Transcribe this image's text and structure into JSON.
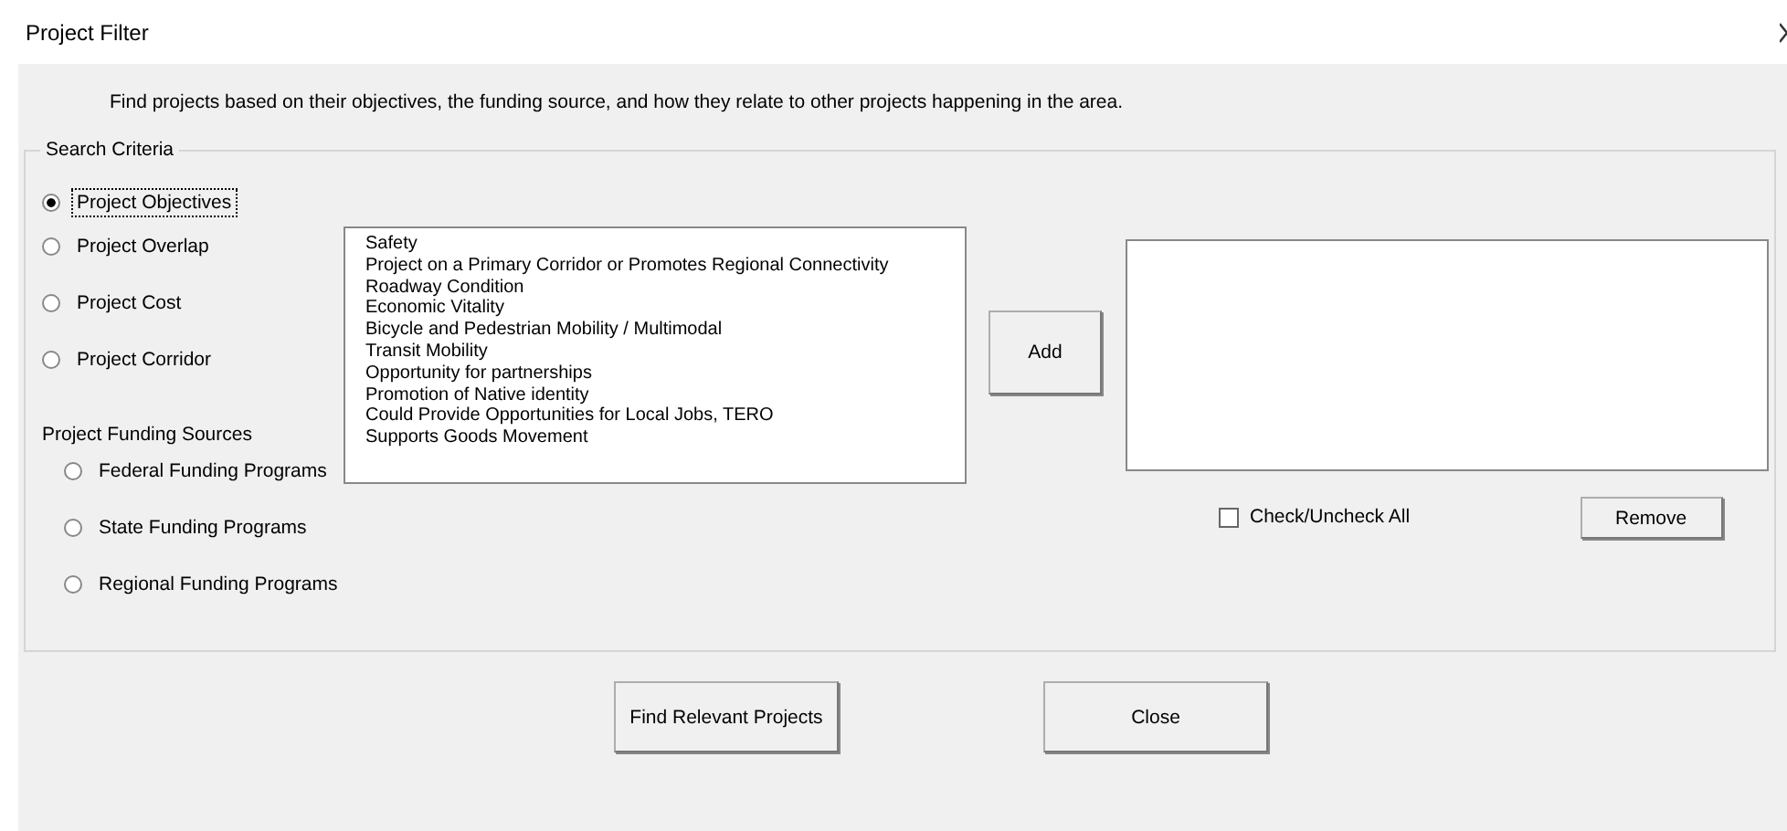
{
  "window": {
    "title": "Project Filter"
  },
  "description": "Find projects based on their objectives, the funding source, and how they relate to other projects happening in the area.",
  "search_criteria": {
    "legend": "Search Criteria",
    "criteria": [
      {
        "label": "Project Objectives",
        "selected": true
      },
      {
        "label": "Project Overlap",
        "selected": false
      },
      {
        "label": "Project Cost",
        "selected": false
      },
      {
        "label": "Project Corridor",
        "selected": false
      }
    ],
    "funding_label": "Project Funding Sources",
    "funding": [
      {
        "label": "Federal Funding Programs",
        "selected": false
      },
      {
        "label": "State Funding Programs",
        "selected": false
      },
      {
        "label": "Regional Funding Programs",
        "selected": false
      }
    ],
    "objectives": [
      "Safety",
      "Project on a Primary Corridor or Promotes Regional Connectivity",
      "Roadway Condition",
      "Economic Vitality",
      "Bicycle and Pedestrian Mobility / Multimodal",
      "Transit Mobility",
      "Opportunity for partnerships",
      "Promotion of Native identity",
      "Could Provide Opportunities for Local Jobs, TERO",
      "Supports Goods Movement"
    ],
    "add_button": "Add",
    "check_all": {
      "label": "Check/Uncheck All",
      "checked": false
    },
    "remove_button": "Remove"
  },
  "buttons": [
    "Find Relevant Projects",
    "Close"
  ]
}
